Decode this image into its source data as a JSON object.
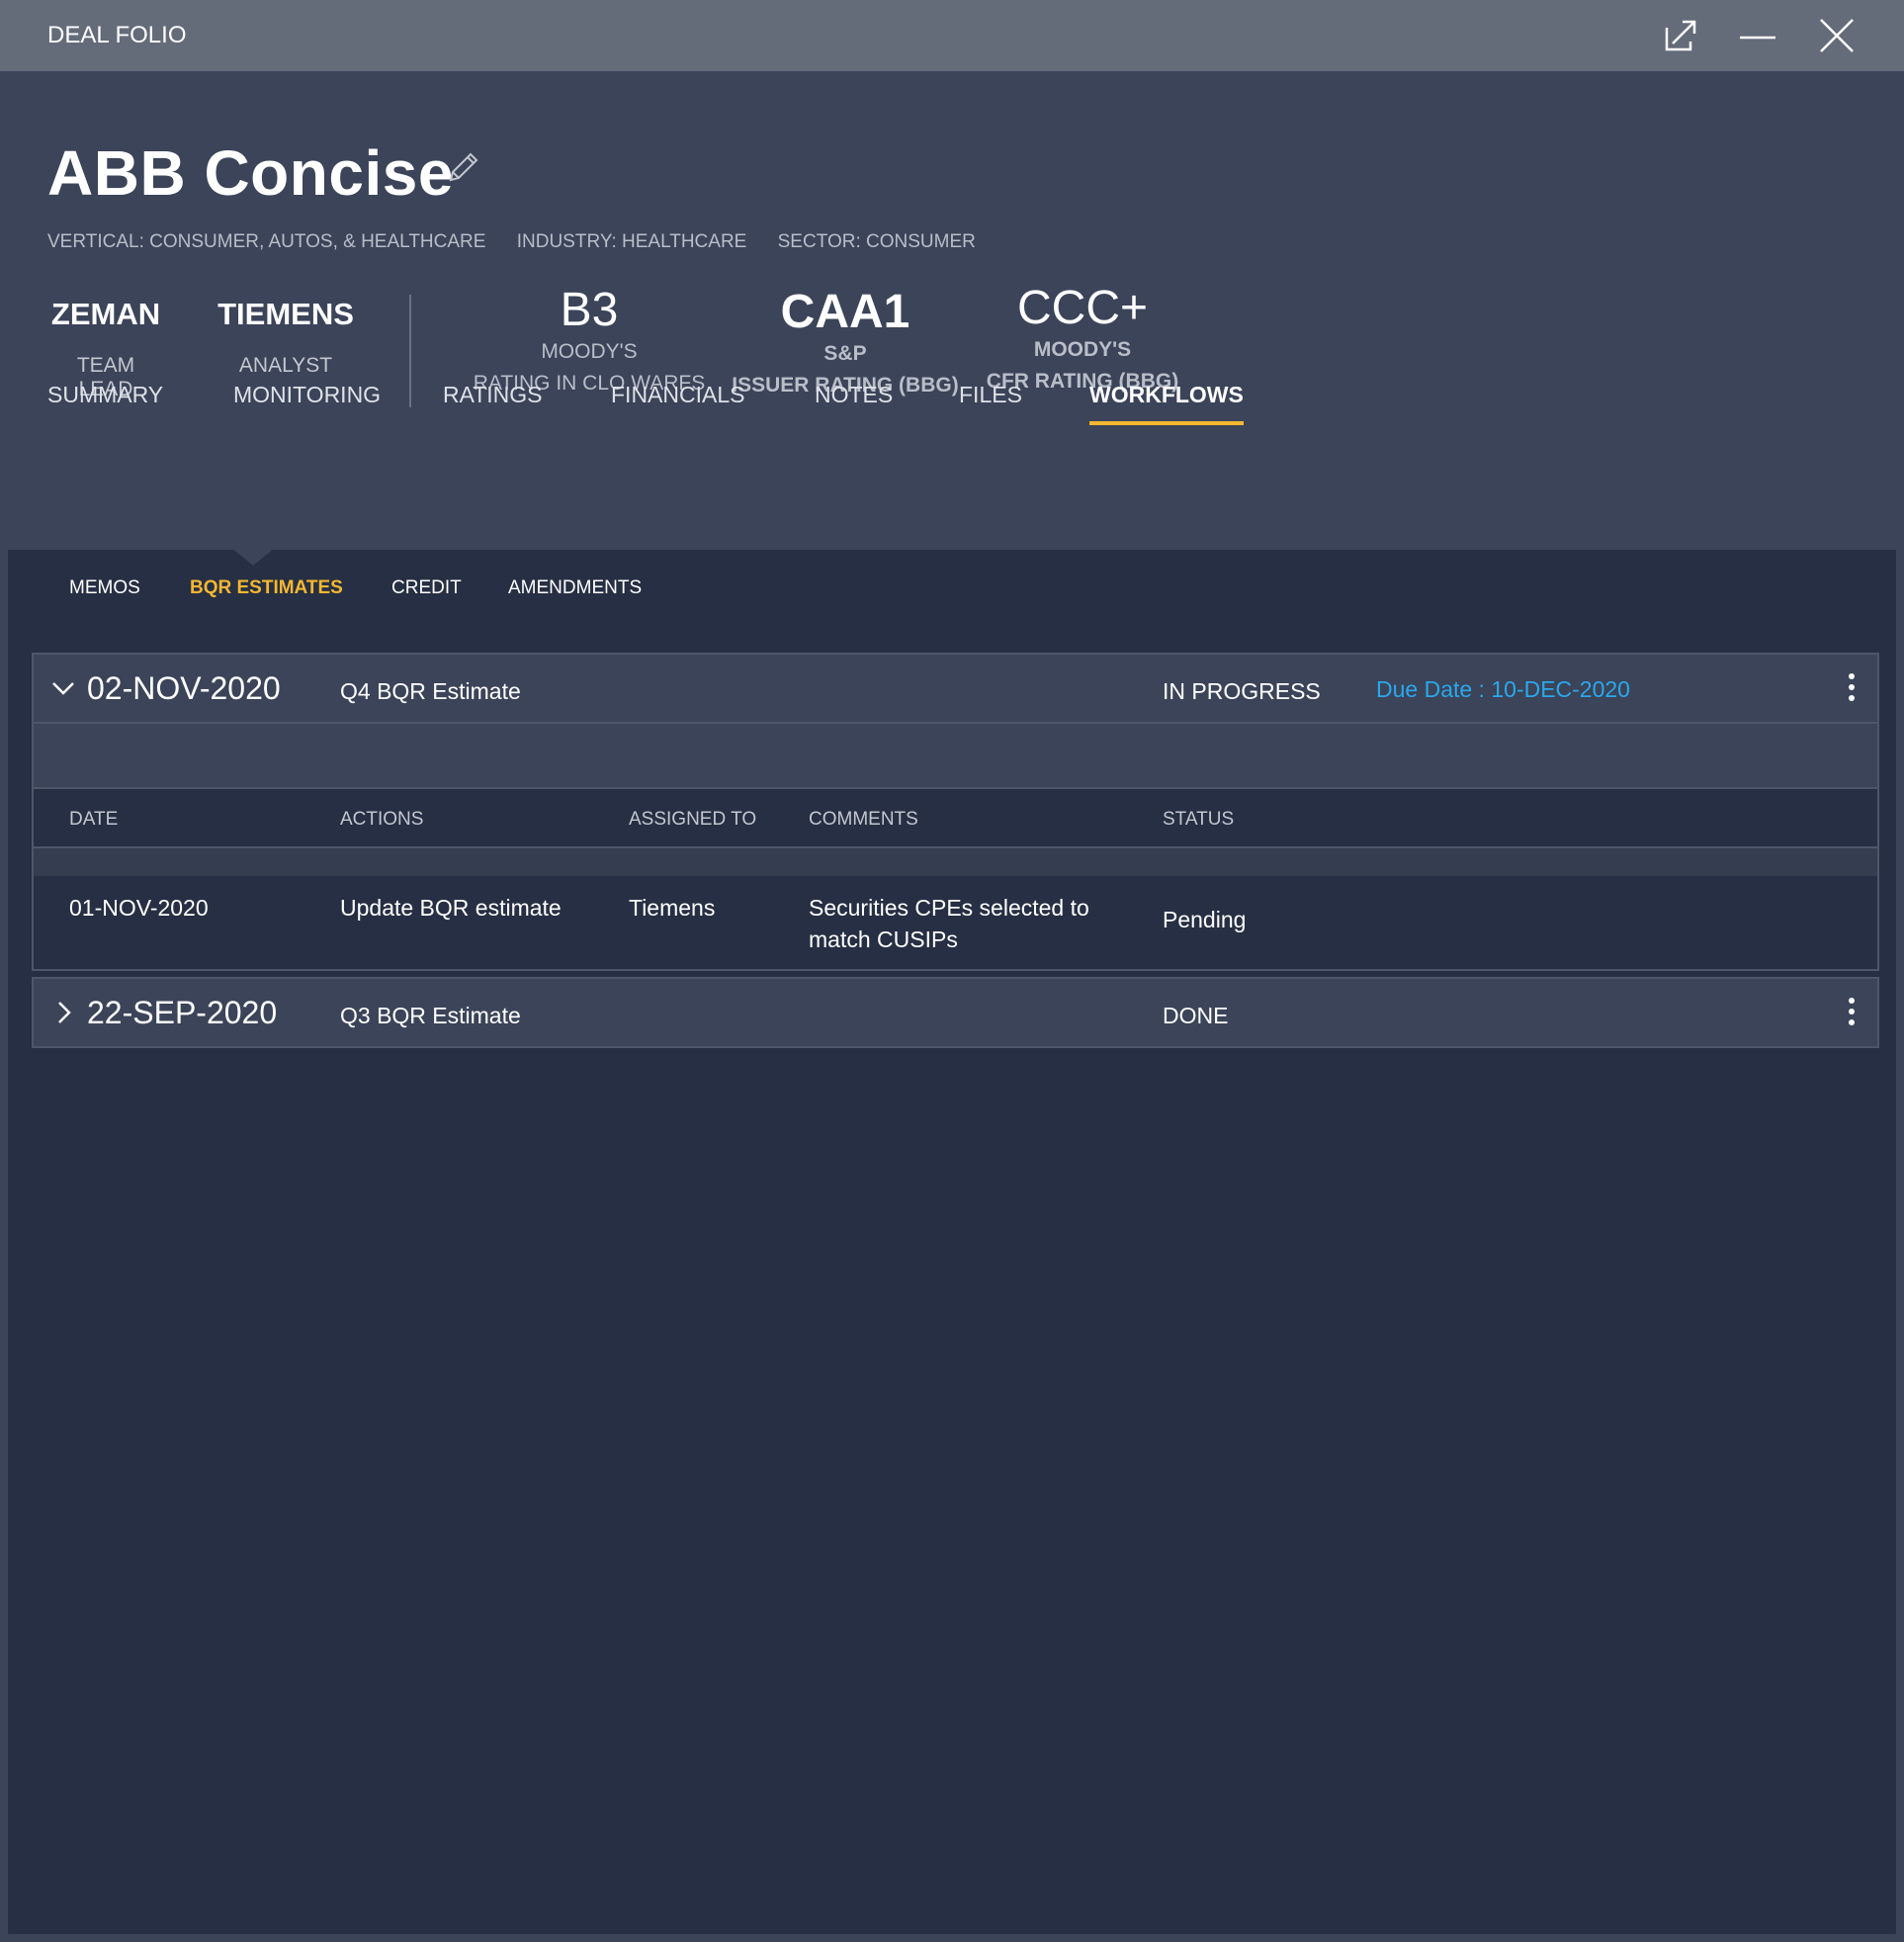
{
  "window": {
    "title": "DEAL FOLIO",
    "controls": [
      "pop-out-icon",
      "minimize-icon",
      "close-icon"
    ]
  },
  "deal": {
    "name": "ABB Concise",
    "vertical": "VERTICAL: CONSUMER, AUTOS, & HEALTHCARE",
    "industry": "INDUSTRY: HEALTHCARE",
    "sector": "SECTOR: CONSUMER"
  },
  "people": [
    {
      "name": "ZEMAN",
      "role": "TEAM LEAD"
    },
    {
      "name": "TIEMENS",
      "role": "ANALYST"
    }
  ],
  "ratings": [
    {
      "value": "B3",
      "line1": "MOODY'S",
      "line2": "RATING IN CLO WARFS"
    },
    {
      "value": "CAA1",
      "line1": "S&P",
      "line2": "ISSUER RATING (BBG)"
    },
    {
      "value": "CCC+",
      "line1": "MOODY'S",
      "line2": "CFR RATING (BBG)"
    }
  ],
  "tabs": [
    "SUMMARY",
    "MONITORING",
    "RATINGS",
    "FINANCIALS",
    "NOTES",
    "FILES",
    "WORKFLOWS"
  ],
  "active_tab": "WORKFLOWS",
  "subtabs": [
    "MEMOS",
    "BQR ESTIMATES",
    "CREDIT",
    "AMENDMENTS"
  ],
  "active_subtab": "BQR ESTIMATES",
  "workflows": [
    {
      "date": "02-NOV-2020",
      "title": "Q4 BQR Estimate",
      "status": "IN PROGRESS",
      "due": "Due Date : 10-DEC-2020",
      "expanded": true,
      "columns": [
        "DATE",
        "ACTIONS",
        "ASSIGNED TO",
        "COMMENTS",
        "STATUS"
      ],
      "rows": [
        {
          "date": "01-NOV-2020",
          "action": "Update BQR estimate",
          "assigned_to": "Tiemens",
          "comment_line1": "Securities CPEs selected to",
          "comment_line2": "match CUSIPs",
          "status": "Pending"
        }
      ]
    },
    {
      "date": "22-SEP-2020",
      "title": "Q3 BQR Estimate",
      "status": "DONE",
      "expanded": false
    }
  ],
  "colors": {
    "accent": "#f5b731",
    "link": "#2aa8ec",
    "header_bg": "#3b4459",
    "panel_bg": "#262f43",
    "titlebar_bg": "#646b79"
  }
}
